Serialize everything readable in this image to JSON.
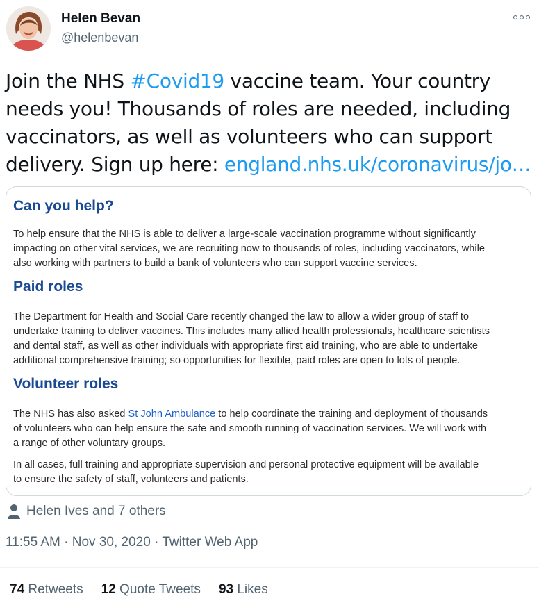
{
  "author": {
    "display_name": "Helen Bevan",
    "handle": "@helenbevan"
  },
  "tweet": {
    "text_part1": "Join the NHS ",
    "hashtag": "#Covid19",
    "text_part2": " vaccine team. Your country needs you! Thousands of roles are needed, including vaccinators, as well as volunteers who can support delivery. Sign up here: ",
    "link": "england.nhs.uk/coronavirus/jo…"
  },
  "card": {
    "heading1": "Can you help?",
    "para1_line1": "To help ensure that the NHS is able to deliver a large-scale vaccination programme without significantly",
    "para1_line2": "impacting on other vital services, we are recruiting now to thousands of roles, including vaccinators, while",
    "para1_line3": "also working with partners to build a bank of volunteers who can support vaccine services.",
    "heading2": "Paid roles",
    "para2_line1": "The Department for Health and Social Care recently changed the law to allow a wider group of staff to",
    "para2_line2": "undertake training to deliver vaccines. This includes many allied health professionals, healthcare scientists",
    "para2_line3": "and dental staff, as well as other individuals with appropriate first aid training, who are able to undertake",
    "para2_line4": "additional comprehensive training; so opportunities for flexible, paid roles are open to lots of people.",
    "heading3": "Volunteer roles",
    "para3_line1_pre": "The NHS has also asked ",
    "para3_link": "St John Ambulance",
    "para3_line1_post": " to help coordinate the training and deployment of thousands",
    "para3_line2": "of volunteers who can help ensure the safe and smooth running of vaccination services. We will work with",
    "para3_line3": "a range of other voluntary groups.",
    "para4_line1": "In all cases, full training and appropriate supervision and personal protective equipment will be available",
    "para4_line2": "to ensure the safety of staff, volunteers and patients."
  },
  "liked_by": "Helen Ives and 7 others",
  "meta": {
    "time": "11:55 AM",
    "sep": " · ",
    "date": "Nov 30, 2020",
    "source": "Twitter Web App"
  },
  "stats": {
    "retweets_count": "74",
    "retweets_label": "Retweets",
    "quotes_count": "12",
    "quotes_label": "Quote Tweets",
    "likes_count": "93",
    "likes_label": "Likes"
  },
  "colors": {
    "accent": "#1d9bf0",
    "nhs_blue": "#1a4a94",
    "secondary_text": "#536471"
  },
  "icons": {
    "more": "more-options-icon",
    "person": "person-icon"
  }
}
